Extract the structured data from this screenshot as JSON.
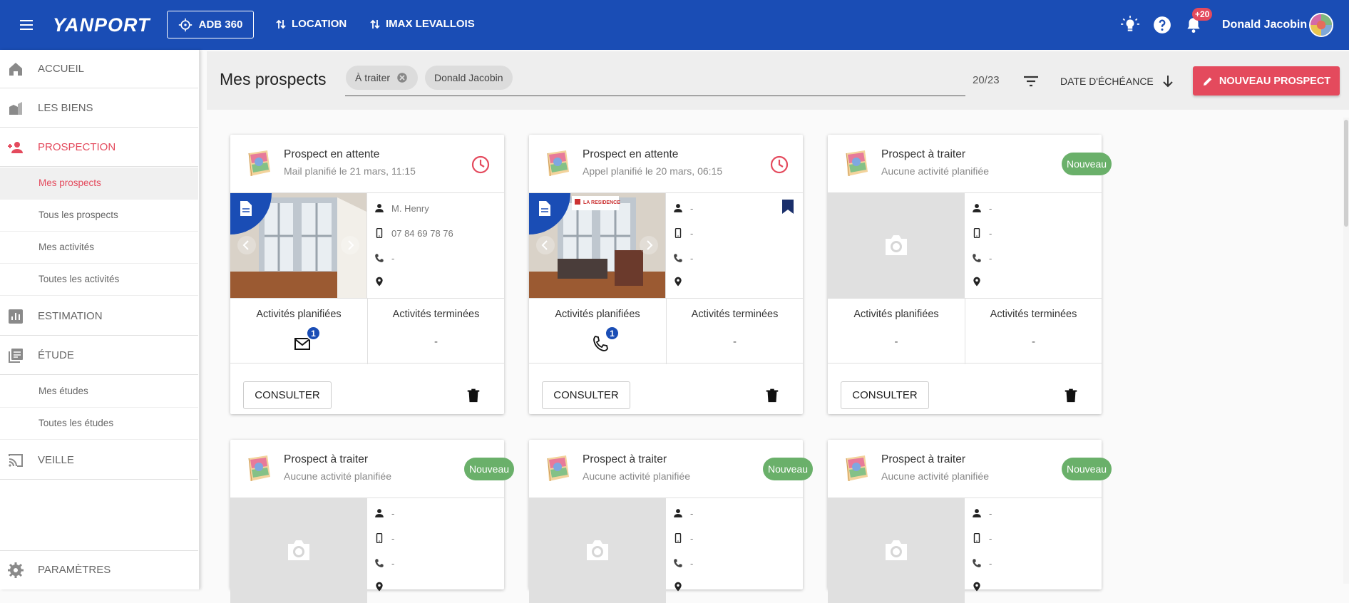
{
  "header": {
    "logo": "YANPORT",
    "adb_label": "ADB 360",
    "location_label": "LOCATION",
    "agency_label": "IMAX LEVALLOIS",
    "notif_badge": "+20",
    "user_name": "Donald Jacobin",
    "icons": [
      "menu-icon",
      "crosshair-icon",
      "swap-icon",
      "lightbulb-icon",
      "help-icon",
      "bell-icon"
    ]
  },
  "sidebar": {
    "items": [
      {
        "label": "ACCUEIL",
        "icon": "home-icon"
      },
      {
        "label": "LES BIENS",
        "icon": "buildings-icon"
      },
      {
        "label": "PROSPECTION",
        "icon": "person-add-icon"
      },
      {
        "label": "ESTIMATION",
        "icon": "bar-chart-icon"
      },
      {
        "label": "ÉTUDE",
        "icon": "library-icon"
      },
      {
        "label": "VEILLE",
        "icon": "cast-icon"
      },
      {
        "label": "PARAMÈTRES",
        "icon": "gear-icon"
      }
    ],
    "prospection_sub": [
      "Mes prospects",
      "Tous les prospects",
      "Mes activités",
      "Toutes les activités"
    ],
    "etude_sub": [
      "Mes études",
      "Toutes les études"
    ]
  },
  "toolbar": {
    "title": "Mes prospects",
    "chips": [
      "À traiter",
      "Donald Jacobin"
    ],
    "count": "20/23",
    "sort_label": "DATE D'ÉCHÉANCE",
    "new_button": "NOUVEAU PROSPECT"
  },
  "labels": {
    "planned": "Activités planifiées",
    "done": "Activités terminées",
    "consult": "CONSULTER",
    "nouveau": "Nouveau",
    "dash": "-"
  },
  "cards": [
    {
      "title": "Prospect en attente",
      "sub": "Mail planifié le 21 mars, 11:15",
      "name": "M. Henry",
      "phone": "07 84 69 78 76",
      "landline": "-",
      "planned_count": "1",
      "done": "-"
    },
    {
      "title": "Prospect en attente",
      "sub": "Appel planifié le 20 mars, 06:15",
      "name": "-",
      "phone": "-",
      "landline": "-",
      "planned_count": "1",
      "done": "-",
      "sign": "LA RESIDENCE"
    },
    {
      "title": "Prospect à traiter",
      "sub": "Aucune activité planifiée",
      "name": "-",
      "phone": "-",
      "landline": "-",
      "planned": "-",
      "done": "-"
    },
    {
      "title": "Prospect à traiter",
      "sub": "Aucune activité planifiée",
      "name": "-",
      "phone": "-",
      "landline": "-"
    },
    {
      "title": "Prospect à traiter",
      "sub": "Aucune activité planifiée",
      "name": "-",
      "phone": "-",
      "landline": "-"
    },
    {
      "title": "Prospect à traiter",
      "sub": "Aucune activité planifiée",
      "name": "-",
      "phone": "-",
      "landline": "-"
    }
  ],
  "colors": {
    "brand": "#1a4db5",
    "accent": "#e44a5d",
    "badge_green": "#6ab06a"
  }
}
